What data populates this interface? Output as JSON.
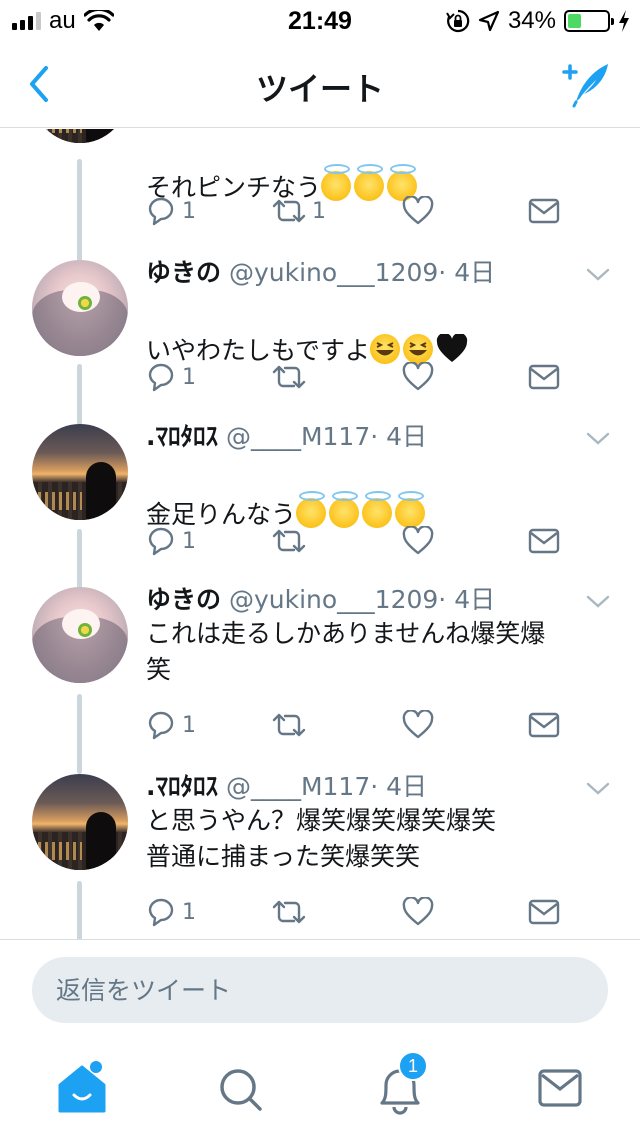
{
  "status_bar": {
    "carrier": "au",
    "time": "21:49",
    "battery_percent": "34%",
    "battery_level": 0.34,
    "signal_bars": 3
  },
  "nav": {
    "title": "ツイート",
    "back_icon": "chevron-left-icon",
    "compose_icon": "compose-tweet-icon"
  },
  "colors": {
    "accent": "#1da1f2",
    "text": "#14171a",
    "secondary": "#657786",
    "thread_line": "#ccd6dd",
    "battery_fill": "#4cd964"
  },
  "tweets": [
    {
      "text": "それピンチなう",
      "emoji": [
        "smiling-face-with-halo",
        "smiling-face-with-halo",
        "smiling-face-with-halo"
      ],
      "reply_count": "1",
      "retweet_count": "1"
    },
    {
      "display_name": "ゆきの",
      "handle": "@yukino___1209",
      "time": "· 4日",
      "text": "いやわたしもですよ",
      "emoji": [
        "grinning-squinting-face",
        "grinning-squinting-face",
        "black-heart"
      ],
      "reply_count": "1",
      "retweet_count": ""
    },
    {
      "display_name": ".ﾏﾛﾀﾛｽ",
      "handle": "@____M117",
      "time": "· 4日",
      "text": "金足りんなう",
      "emoji": [
        "smiling-face-with-halo",
        "smiling-face-with-halo",
        "smiling-face-with-halo",
        "smiling-face-with-halo"
      ],
      "reply_count": "1",
      "retweet_count": ""
    },
    {
      "display_name": "ゆきの",
      "handle": "@yukino___1209",
      "time": "· 4日",
      "text": "これは走るしかありませんね爆笑爆\n笑",
      "emoji": [],
      "reply_count": "1",
      "retweet_count": ""
    },
    {
      "display_name": ".ﾏﾛﾀﾛｽ",
      "handle": "@____M117",
      "time": "· 4日",
      "text": "と思うやん？爆笑爆笑爆笑爆笑\n普通に捕まった笑爆笑笑",
      "emoji": [],
      "reply_count": "1",
      "retweet_count": ""
    }
  ],
  "reply_bar": {
    "placeholder": "返信をツイート"
  },
  "tab_bar": {
    "tabs": [
      {
        "name": "home",
        "icon": "home-icon"
      },
      {
        "name": "search",
        "icon": "search-icon"
      },
      {
        "name": "notifications",
        "icon": "bell-icon",
        "badge": "1"
      },
      {
        "name": "messages",
        "icon": "envelope-icon"
      }
    ]
  }
}
